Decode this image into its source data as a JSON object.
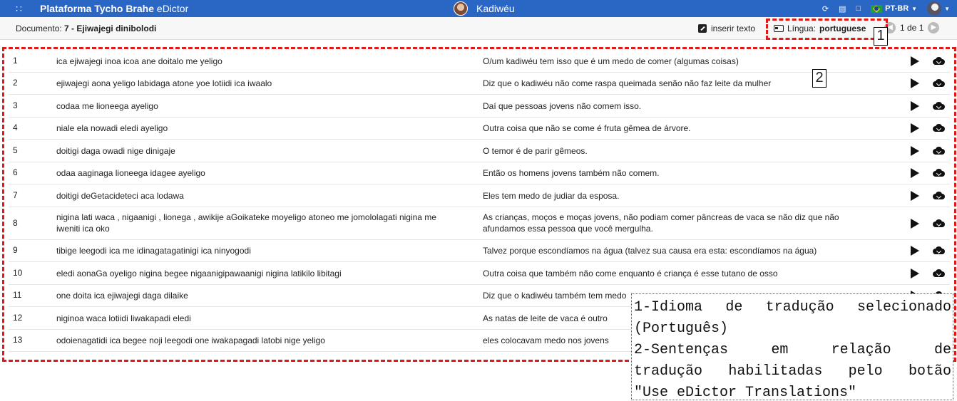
{
  "topbar": {
    "grid_icon": "apps-grid-icon",
    "brand_bold": "Plataforma Tycho Brahe",
    "brand_app": "eDictor",
    "project": "Kadiwéu",
    "language": "PT-BR",
    "bg_color": "#2a66c4"
  },
  "subbar": {
    "doc_label": "Documento:",
    "doc_name": "7 - Ejiwajegi dinibolodi",
    "insert_label": "inserir texto",
    "lingua_label": "Língua:",
    "lingua_value": "portuguese",
    "pager": "1 de 1"
  },
  "annotations": {
    "n1": "1",
    "n2": "2",
    "dash_color": "#e01818"
  },
  "rows": [
    {
      "n": "1",
      "src": "ica ejiwajegi inoa icoa ane doitalo me yeligo",
      "tr": "O/um kadiwéu tem isso que é um medo de comer (algumas coisas)"
    },
    {
      "n": "2",
      "src": "ejiwajegi aona yeligo labidaga atone yoe lotiidi ica iwaalo",
      "tr": "Diz que o kadiwéu não come raspa queimada senão não faz leite da mulher"
    },
    {
      "n": "3",
      "src": "codaa me lioneega ayeligo",
      "tr": "Daí que pessoas jovens não comem isso."
    },
    {
      "n": "4",
      "src": "niale ela nowadi eledi ayeligo",
      "tr": "Outra coisa que não se come é fruta gêmea de árvore."
    },
    {
      "n": "5",
      "src": "doitigi daga owadi nige dinigaje",
      "tr": "O temor é de parir gêmeos."
    },
    {
      "n": "6",
      "src": "odaa aaginaga lioneega idagee ayeligo",
      "tr": "Então os homens jovens também não comem."
    },
    {
      "n": "7",
      "src": "doitigi deGetacideteci aca lodawa",
      "tr": "Eles tem medo de judiar da esposa."
    },
    {
      "n": "8",
      "src": "nigina lati waca , nigaanigi , lionega , awikije aGoikateke moyeligo atoneo me jomololagati nigina me iweniti ica oko",
      "tr": "As crianças, moços e moças jovens, não podiam comer pâncreas de vaca se não diz que não afundamos essa pessoa que você mergulha."
    },
    {
      "n": "9",
      "src": "tibige leegodi ica me idinagatagatinigi ica ninyogodi",
      "tr": "Talvez porque escondíamos na água (talvez sua causa era esta: escondíamos na água)"
    },
    {
      "n": "10",
      "src": "eledi aonaGa oyeligo nigina begee nigaanigipawaanigi nigina latikilo libitagi",
      "tr": "Outra coisa que também não come enquanto é criança é esse tutano de osso"
    },
    {
      "n": "11",
      "src": "one doita ica ejiwajegi daga dilaike",
      "tr": "Diz que o kadiwéu também tem medo"
    },
    {
      "n": "12",
      "src": "niginoa waca lotiidi liwakapadi eledi",
      "tr": "As natas de leite de vaca é outro"
    },
    {
      "n": "13",
      "src": "odoienagatidi ica begee noji leegodi one iwakapagadi latobi nige yeligo",
      "tr": "eles colocavam medo nos jovens"
    }
  ],
  "note": {
    "l1": "1-Idioma de tradução selecionado",
    "l2": "(Português)",
    "l3": "2-Sentenças em relação de",
    "l4": "tradução habilitadas pelo botão",
    "l5": "\"Use eDictor Translations\""
  }
}
